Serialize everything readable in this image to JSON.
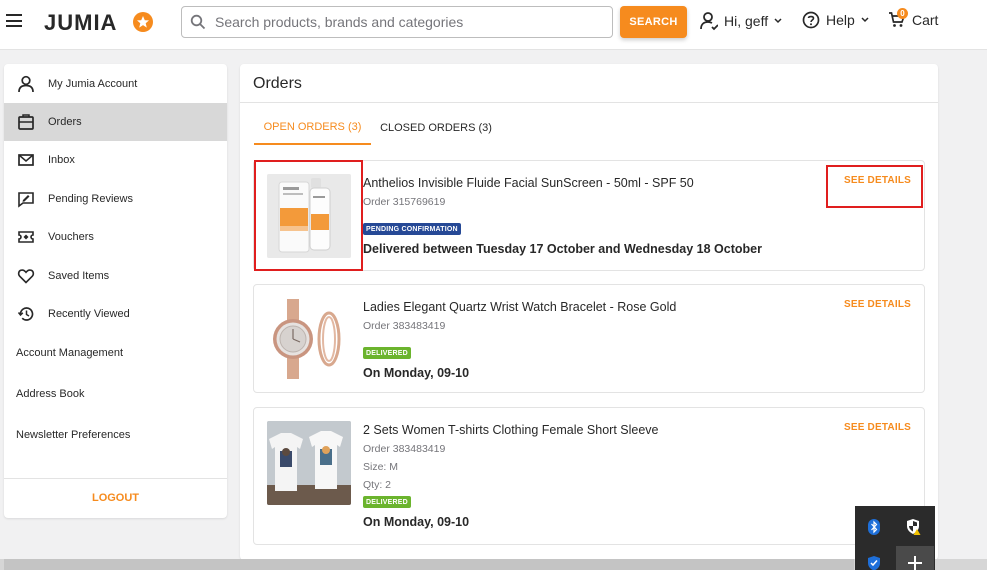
{
  "header": {
    "logo_text": "JUMIA",
    "search": {
      "placeholder": "Search products, brands and categories",
      "value": ""
    },
    "search_button": "SEARCH",
    "account_label": "Hi, geff",
    "help_label": "Help",
    "cart_label": "Cart",
    "cart_count": "0",
    "accent_color": "#f68b1e"
  },
  "sidebar": {
    "items": [
      {
        "label": "My Jumia Account",
        "icon": "person-icon"
      },
      {
        "label": "Orders",
        "icon": "orders-icon",
        "active": true
      },
      {
        "label": "Inbox",
        "icon": "mail-icon"
      },
      {
        "label": "Pending Reviews",
        "icon": "review-icon"
      },
      {
        "label": "Vouchers",
        "icon": "voucher-icon"
      },
      {
        "label": "Saved Items",
        "icon": "heart-icon"
      },
      {
        "label": "Recently Viewed",
        "icon": "history-icon"
      }
    ],
    "plain_items": [
      "Account Management",
      "Address Book",
      "Newsletter Preferences"
    ],
    "logout": "LOGOUT"
  },
  "main": {
    "title": "Orders",
    "tabs": [
      {
        "label": "OPEN ORDERS (3)",
        "active": true
      },
      {
        "label": "CLOSED ORDERS (3)",
        "active": false
      }
    ],
    "orders": [
      {
        "name": "Anthelios Invisible Fluide Facial SunScreen - 50ml - SPF 50",
        "order_no": "Order 315769619",
        "status": "PENDING CONFIRMATION",
        "status_color": "#264996",
        "date": "Delivered between Tuesday 17 October and Wednesday 18 October",
        "action": "SEE DETAILS"
      },
      {
        "name": "Ladies Elegant Quartz Wrist Watch Bracelet - Rose Gold",
        "order_no": "Order 383483419",
        "status": "DELIVERED",
        "status_color": "#6bb42d",
        "date": "On Monday, 09-10",
        "action": "SEE DETAILS"
      },
      {
        "name": "2 Sets Women T-shirts Clothing Female Short Sleeve",
        "order_no": "Order 383483419",
        "size": "Size: M",
        "qty": "Qty: 2",
        "status": "DELIVERED",
        "status_color": "#6bb42d",
        "date": "On Monday, 09-10",
        "action": "SEE DETAILS"
      }
    ]
  },
  "tray": {
    "icons": [
      "bluetooth-icon",
      "security-shield-icon",
      "defender-icon",
      "add-icon"
    ]
  }
}
